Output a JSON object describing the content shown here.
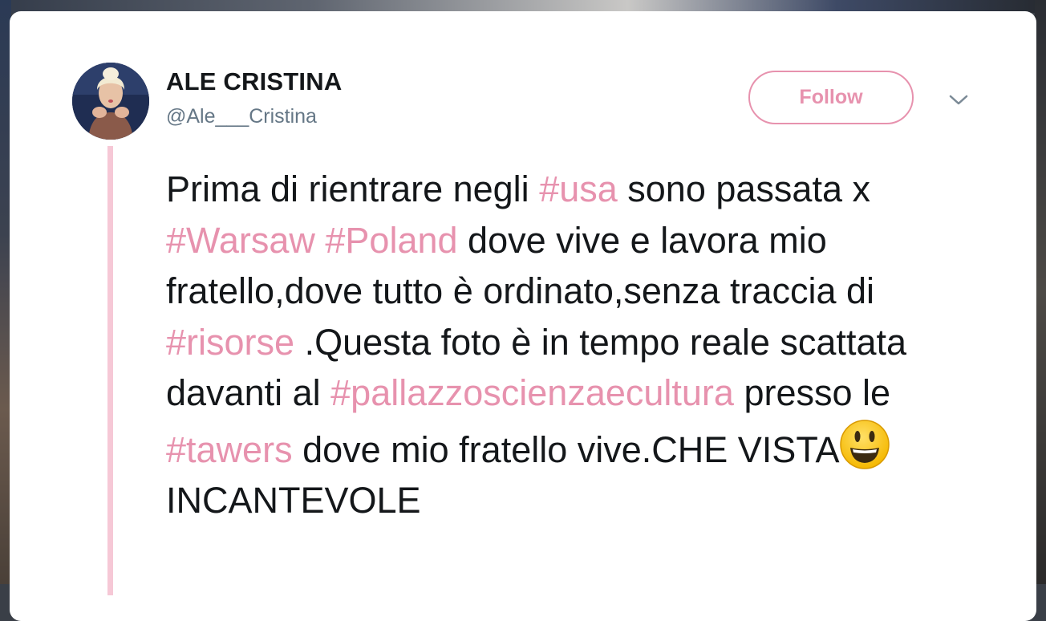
{
  "tweet": {
    "author": {
      "display_name": "ALE CRISTINA",
      "handle": "@Ale___Cristina"
    },
    "follow_label": "Follow",
    "text": [
      {
        "type": "text",
        "value": "Prima di rientrare negli "
      },
      {
        "type": "hashtag",
        "value": "#usa"
      },
      {
        "type": "text",
        "value": " sono passata x "
      },
      {
        "type": "hashtag",
        "value": "#Warsaw"
      },
      {
        "type": "text",
        "value": " "
      },
      {
        "type": "hashtag",
        "value": "#Poland"
      },
      {
        "type": "text",
        "value": " dove vive e lavora mio fratello,dove tutto è ordinato,senza traccia di "
      },
      {
        "type": "hashtag",
        "value": "#risorse"
      },
      {
        "type": "text",
        "value": " .Questa foto è in tempo reale scattata davanti al "
      },
      {
        "type": "hashtag",
        "value": "#pallazzoscienzaecultura"
      },
      {
        "type": "text",
        "value": " presso le "
      },
      {
        "type": "hashtag",
        "value": "#tawers"
      },
      {
        "type": "text",
        "value": " dove mio fratello vive.CHE VISTA"
      },
      {
        "type": "emoji",
        "value": "smiley"
      },
      {
        "type": "text",
        "value": "INCANTEVOLE"
      }
    ]
  },
  "icons": {
    "menu": "chevron-down-icon",
    "emoji": "smiling-face-emoji"
  },
  "colors": {
    "accent": "#e792ae",
    "thread_line": "#f6c8d6",
    "text": "#14171a",
    "muted": "#657786"
  }
}
